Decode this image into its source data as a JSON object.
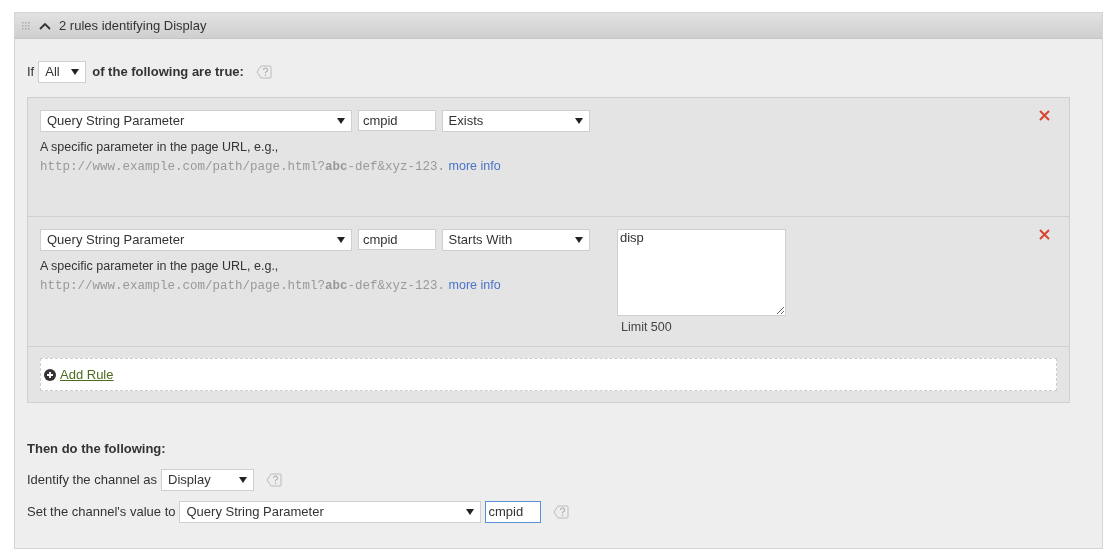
{
  "panel": {
    "title": "2 rules identifying Display",
    "expanded": true
  },
  "condition": {
    "prefix": "If",
    "match": "All",
    "suffix": "of the following are true:"
  },
  "rules": [
    {
      "kind": "plain",
      "type": "Query String Parameter",
      "key": "cmpid",
      "operator": "Exists",
      "description": "A specific parameter in the page URL, e.g.,",
      "example": "http://www.example.com/path/page.html?**abc**-def&xyz-123.",
      "link": "more info"
    },
    {
      "kind": "text",
      "type": "Query String Parameter",
      "key": "cmpid",
      "operator": "Starts With",
      "value": "disp",
      "limit": "Limit 500",
      "description": "A specific parameter in the page URL, e.g.,",
      "example": "http://www.example.com/path/page.html?**abc**-def&xyz-123.",
      "link": "more info"
    }
  ],
  "add_rule": "Add Rule",
  "actions": {
    "heading": "Then do the following:",
    "rows": [
      {
        "label": "Identify the channel as",
        "select": "Display"
      },
      {
        "label": "Set the channel's value to",
        "select": "Query String Parameter",
        "value": "cmpid",
        "focused": true
      }
    ]
  }
}
